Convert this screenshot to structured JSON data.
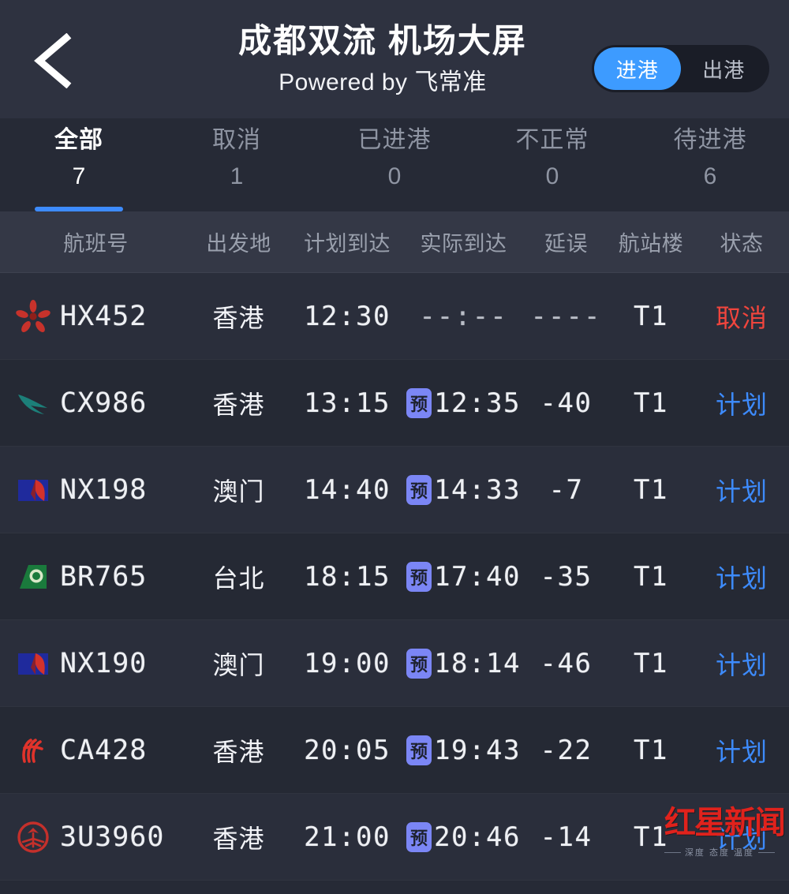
{
  "header": {
    "back_icon": "chevron-left-icon",
    "title": "成都双流 机场大屏",
    "subtitle": "Powered by 飞常准",
    "toggle": {
      "arrival_label": "进港",
      "departure_label": "出港",
      "selected": "进港"
    }
  },
  "tabs": [
    {
      "label": "全部",
      "count": "7",
      "active": true
    },
    {
      "label": "取消",
      "count": "1",
      "active": false
    },
    {
      "label": "已进港",
      "count": "0",
      "active": false
    },
    {
      "label": "不正常",
      "count": "0",
      "active": false
    },
    {
      "label": "待进港",
      "count": "6",
      "active": false
    }
  ],
  "table": {
    "columns": [
      "航班号",
      "出发地",
      "计划到达",
      "实际到达",
      "延误",
      "航站楼",
      "状态"
    ],
    "estimate_badge": "预",
    "rows": [
      {
        "airline": "hong-kong-airlines",
        "flight_no": "HX452",
        "origin": "香港",
        "scheduled": "12:30",
        "actual": "--:--",
        "actual_estimated": false,
        "delay": "----",
        "terminal": "T1",
        "status": "取消",
        "status_type": "cancelled"
      },
      {
        "airline": "cathay-pacific",
        "flight_no": "CX986",
        "origin": "香港",
        "scheduled": "13:15",
        "actual": "12:35",
        "actual_estimated": true,
        "delay": "-40",
        "terminal": "T1",
        "status": "计划",
        "status_type": "planned"
      },
      {
        "airline": "air-macau",
        "flight_no": "NX198",
        "origin": "澳门",
        "scheduled": "14:40",
        "actual": "14:33",
        "actual_estimated": true,
        "delay": "-7",
        "terminal": "T1",
        "status": "计划",
        "status_type": "planned"
      },
      {
        "airline": "eva-air",
        "flight_no": "BR765",
        "origin": "台北",
        "scheduled": "18:15",
        "actual": "17:40",
        "actual_estimated": true,
        "delay": "-35",
        "terminal": "T1",
        "status": "计划",
        "status_type": "planned"
      },
      {
        "airline": "air-macau",
        "flight_no": "NX190",
        "origin": "澳门",
        "scheduled": "19:00",
        "actual": "18:14",
        "actual_estimated": true,
        "delay": "-46",
        "terminal": "T1",
        "status": "计划",
        "status_type": "planned"
      },
      {
        "airline": "air-china",
        "flight_no": "CA428",
        "origin": "香港",
        "scheduled": "20:05",
        "actual": "19:43",
        "actual_estimated": true,
        "delay": "-22",
        "terminal": "T1",
        "status": "计划",
        "status_type": "planned"
      },
      {
        "airline": "sichuan-airlines",
        "flight_no": "3U3960",
        "origin": "香港",
        "scheduled": "21:00",
        "actual": "20:46",
        "actual_estimated": true,
        "delay": "-14",
        "terminal": "T1",
        "status": "计划",
        "status_type": "planned"
      }
    ]
  },
  "watermark": {
    "text": "红星新闻",
    "subtext": "深度 态度 温度"
  },
  "colors": {
    "accent_blue": "#3d8bfd",
    "status_cancelled": "#f0453d",
    "status_planned": "#3d8bfd",
    "badge_estimate": "#7b86f5",
    "page_bg": "#262a36",
    "header_bg": "#2e3240"
  }
}
